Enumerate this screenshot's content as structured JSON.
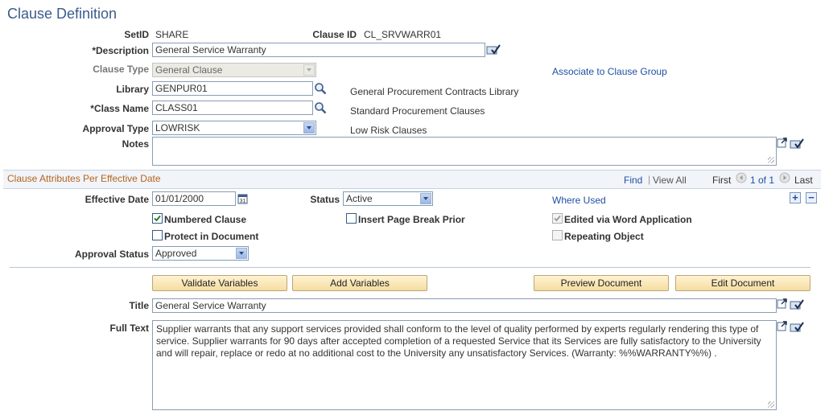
{
  "page": {
    "title": "Clause Definition"
  },
  "header": {
    "setid_label": "SetID",
    "setid_value": "SHARE",
    "clause_id_label": "Clause ID",
    "clause_id_value": "CL_SRVWARR01",
    "description_label": "*Description",
    "description_value": "General Service Warranty",
    "clause_type_label": "Clause Type",
    "clause_type_value": "General Clause",
    "associate_link": "Associate to Clause Group",
    "library_label": "Library",
    "library_value": "GENPUR01",
    "library_desc": "General Procurement Contracts Library",
    "class_name_label": "*Class Name",
    "class_name_value": "CLASS01",
    "class_name_desc": "Standard Procurement Clauses",
    "approval_type_label": "Approval Type",
    "approval_type_value": "LOWRISK",
    "approval_type_desc": "Low Risk Clauses",
    "notes_label": "Notes",
    "notes_value": ""
  },
  "section": {
    "title": "Clause Attributes Per Effective Date",
    "find": "Find",
    "view_all": "View All",
    "first": "First",
    "pager": "1 of 1",
    "last": "Last",
    "effective_date_label": "Effective Date",
    "effective_date_value": "01/01/2000",
    "status_label": "Status",
    "status_value": "Active",
    "where_used": "Where Used",
    "numbered_clause": "Numbered Clause",
    "insert_page_break": "Insert Page Break Prior",
    "edited_via_word": "Edited via Word Application",
    "protect_in_document": "Protect in Document",
    "repeating_object": "Repeating Object",
    "approval_status_label": "Approval Status",
    "approval_status_value": "Approved",
    "validate_variables": "Validate Variables",
    "add_variables": "Add Variables",
    "preview_document": "Preview Document",
    "edit_document": "Edit Document",
    "title_label": "Title",
    "title_value": "General Service Warranty",
    "full_text_label": "Full Text",
    "full_text_value": "Supplier warrants that any support services provided shall conform to the level of quality performed by experts regularly rendering this type of service.  Supplier warrants for 90 days after accepted completion of a requested Service that its Services are fully satisfactory to the University and will repair, replace or redo at no additional cost to the University any unsatisfactory Services.  (Warranty:  %%WARRANTY%%) ."
  },
  "checkboxes": {
    "numbered_clause": true,
    "insert_page_break": false,
    "edited_via_word": true,
    "protect_in_document": false,
    "repeating_object": false
  }
}
